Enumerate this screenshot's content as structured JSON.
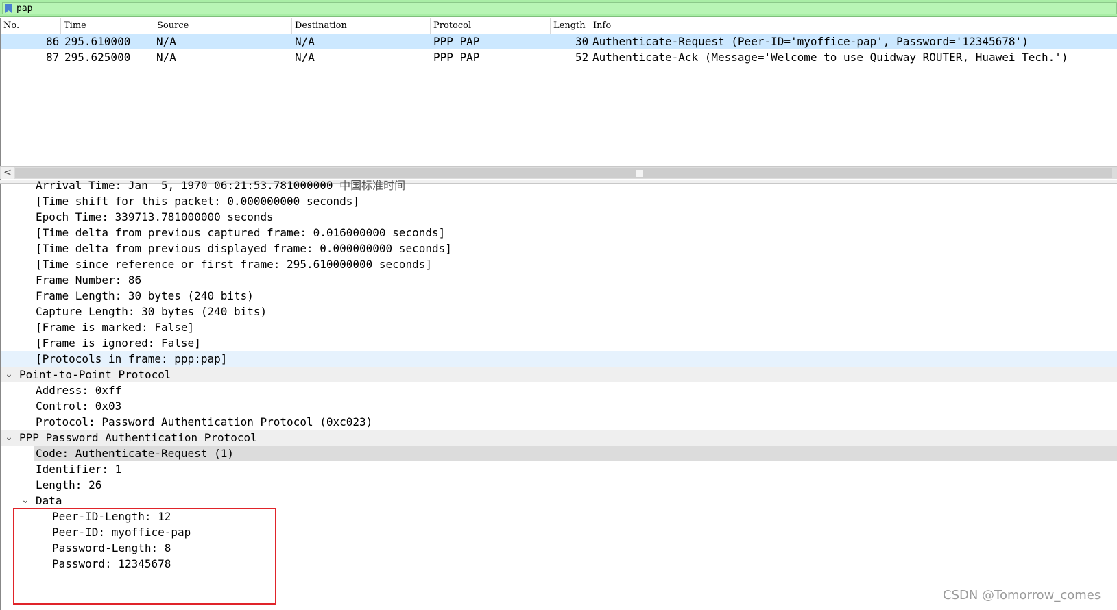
{
  "filter": {
    "icon": "bookmark-icon",
    "value": "pap"
  },
  "columns": [
    "No.",
    "Time",
    "Source",
    "Destination",
    "Protocol",
    "Length",
    "Info"
  ],
  "packets": [
    {
      "no": "86",
      "time": "295.610000",
      "source": "N/A",
      "destination": "N/A",
      "protocol": "PPP PAP",
      "length": "30",
      "info": "Authenticate-Request (Peer-ID='myoffice-pap', Password='12345678')"
    },
    {
      "no": "87",
      "time": "295.625000",
      "source": "N/A",
      "destination": "N/A",
      "protocol": "PPP PAP",
      "length": "52",
      "info": "Authenticate-Ack (Message='Welcome to use Quidway ROUTER, Huawei Tech.')"
    }
  ],
  "scrollbar": {
    "left_arrow": "<"
  },
  "details": {
    "frame": [
      "Arrival Time: Jan  5, 1970 06:21:53.781000000",
      "[Time shift for this packet: 0.000000000 seconds]",
      "Epoch Time: 339713.781000000 seconds",
      "[Time delta from previous captured frame: 0.016000000 seconds]",
      "[Time delta from previous displayed frame: 0.000000000 seconds]",
      "[Time since reference or first frame: 295.610000000 seconds]",
      "Frame Number: 86",
      "Frame Length: 30 bytes (240 bits)",
      "Capture Length: 30 bytes (240 bits)",
      "[Frame is marked: False]",
      "[Frame is ignored: False]",
      "[Protocols in frame: ppp:pap]"
    ],
    "arrival_timezone": "中国标准时间",
    "ppp": {
      "title": "Point-to-Point Protocol",
      "fields": [
        "Address: 0xff",
        "Control: 0x03",
        "Protocol: Password Authentication Protocol (0xc023)"
      ]
    },
    "pap": {
      "title": "PPP Password Authentication Protocol",
      "fields": [
        "Code: Authenticate-Request (1)",
        "Identifier: 1",
        "Length: 26"
      ],
      "data_title": "Data",
      "data_fields": [
        "Peer-ID-Length: 12",
        "Peer-ID: myoffice-pap",
        "Password-Length: 8",
        "Password: 12345678"
      ]
    }
  },
  "watermark": "CSDN @Tomorrow_comes",
  "colors": {
    "filter_bg": "#a9eea6",
    "selected_row": "#cce8ff",
    "annotation_box": "#e0242a"
  }
}
